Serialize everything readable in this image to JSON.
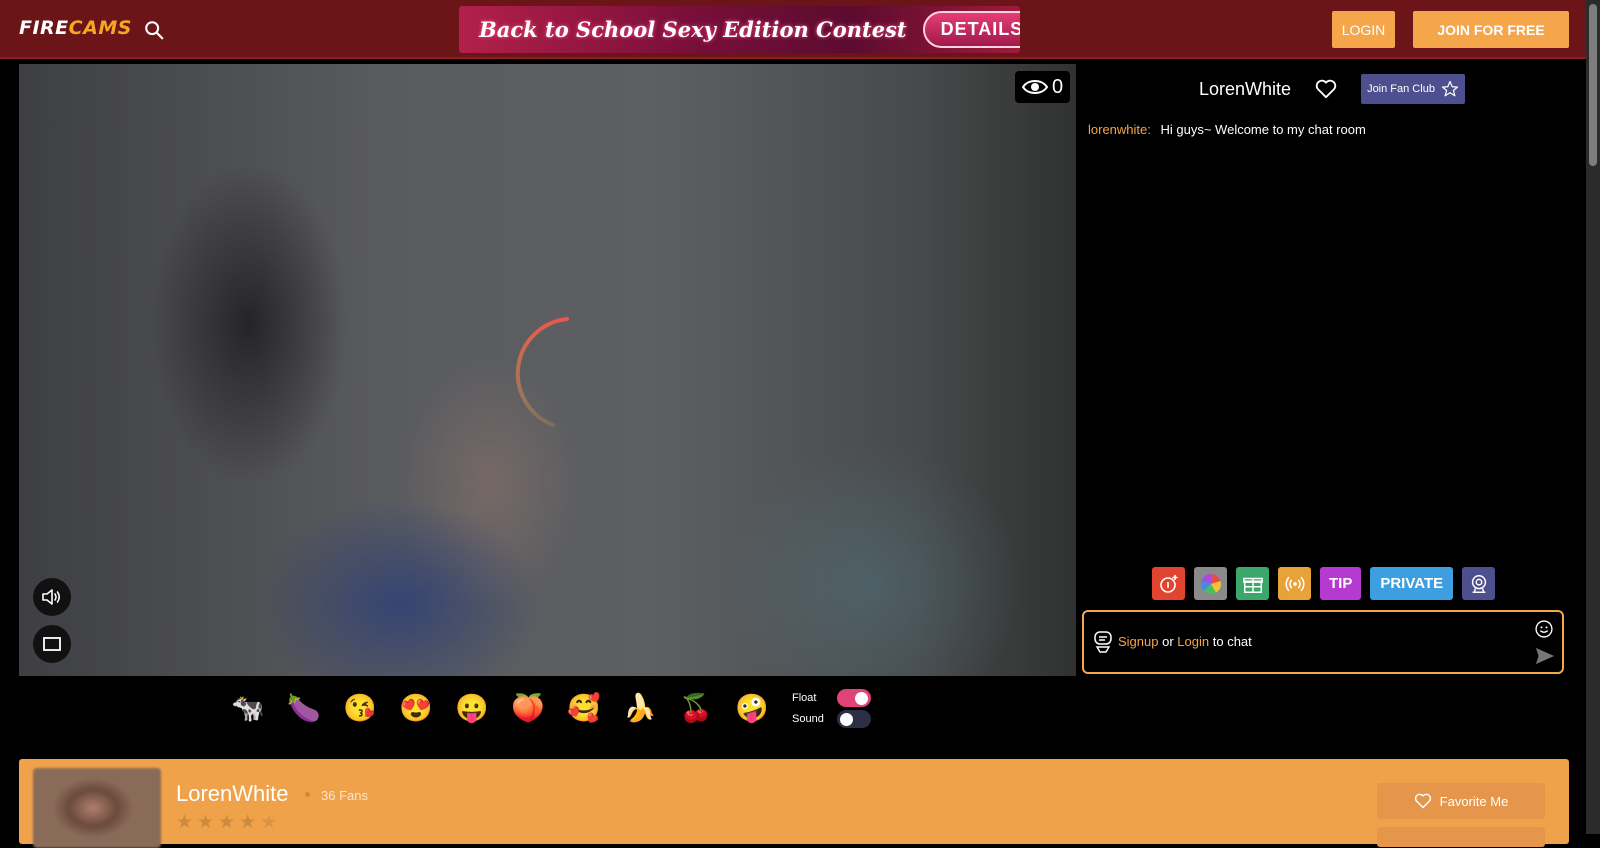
{
  "header": {
    "logo_part1": "FIRE",
    "logo_part2": "CAMS",
    "banner_title": "Back to School Sexy Edition Contest",
    "banner_button": "DETAILS",
    "login_label": "LOGIN",
    "join_label": "JOIN FOR FREE"
  },
  "video": {
    "viewer_count": "0"
  },
  "chat": {
    "model_name": "LorenWhite",
    "fan_club_label": "Join Fan Club",
    "messages": [
      {
        "user": "lorenwhite:",
        "text": "Hi guys~ Welcome to my chat room"
      }
    ],
    "tools": {
      "tip_label": "TIP",
      "private_label": "PRIVATE"
    },
    "input": {
      "signup": "Signup",
      "or": "or",
      "login": "Login",
      "suffix": "to chat"
    }
  },
  "emojis": [
    "🐄",
    "🍆",
    "😘",
    "😍",
    "😛",
    "🍑",
    "🥰",
    "🍌",
    "🍒",
    "🤪"
  ],
  "toggles": {
    "float_label": "Float",
    "float_on": true,
    "sound_label": "Sound",
    "sound_on": false
  },
  "profile": {
    "name": "LorenWhite",
    "fans": "36 Fans",
    "rating_stars": 4.5,
    "favorite_label": "Favorite Me"
  },
  "colors": {
    "header_bg": "#6b1518",
    "accent": "#f5a54a",
    "tip": "#b43ad0",
    "private": "#3d9fe0",
    "fan_club": "#4e4f8f"
  }
}
